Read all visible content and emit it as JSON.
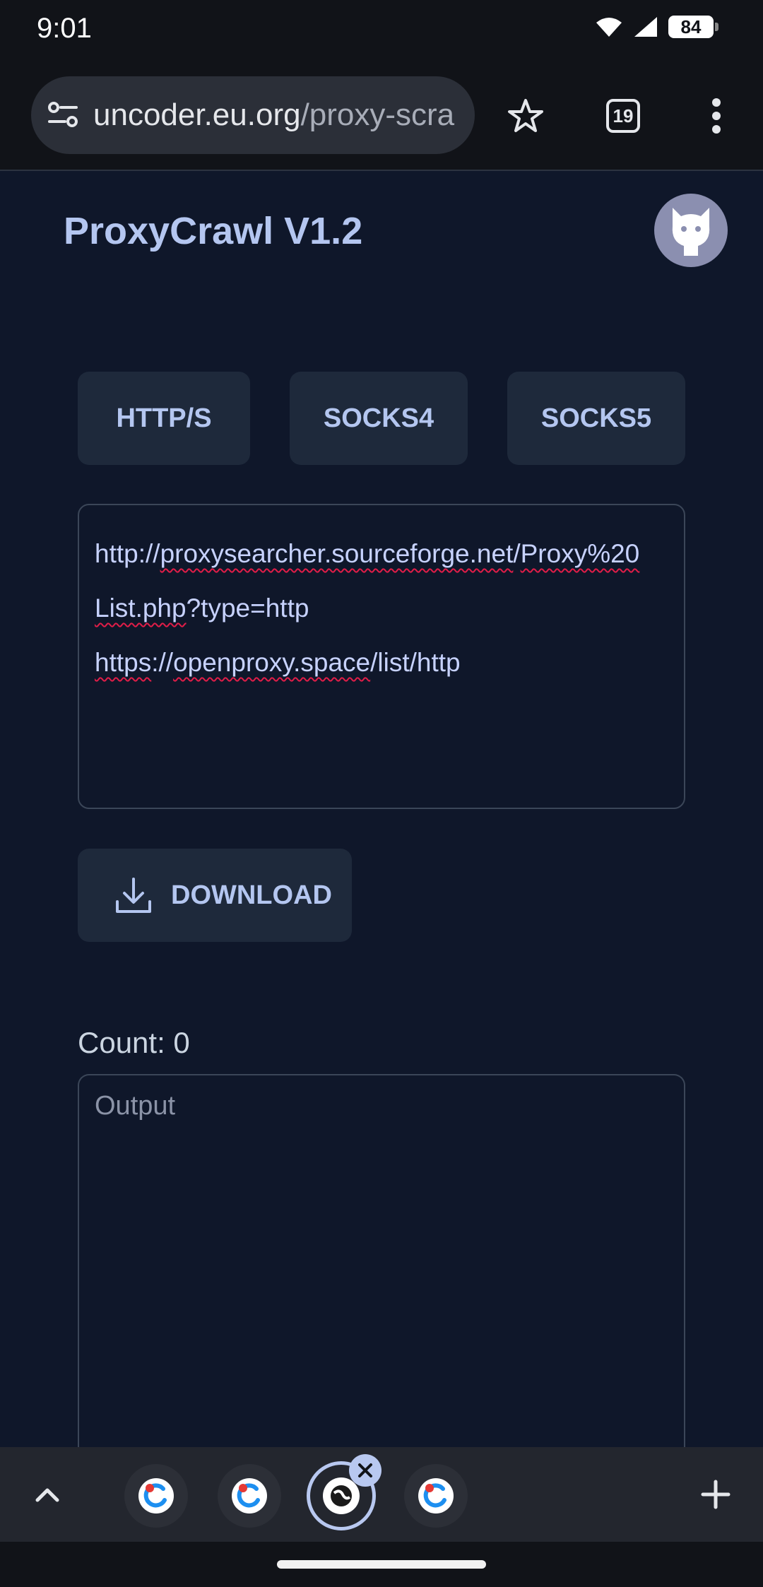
{
  "status": {
    "time": "9:01",
    "battery": "84"
  },
  "browser": {
    "url_host": "uncoder.eu.org",
    "url_path": "/proxy-scra",
    "tab_count": "19"
  },
  "app": {
    "title": "ProxyCrawl V1.2",
    "types": [
      {
        "label": "HTTP/S"
      },
      {
        "label": "SOCKS4"
      },
      {
        "label": "SOCKS5"
      }
    ],
    "sources": {
      "line1_prefix": "http://",
      "line1_host": "proxysearcher.sourceforge.net",
      "line1_sep": "/",
      "line1_path": "Proxy%20",
      "line2_word": "List.php",
      "line2_rest": "?type=http",
      "line3_scheme": "https",
      "line3_sep": "://",
      "line3_host": "openproxy.space",
      "line3_path": "/list/http"
    },
    "download_label": "DOWNLOAD",
    "count_label": "Count: 0",
    "output_placeholder": "Output"
  },
  "tab_strip": {
    "tabs": [
      {
        "icon": "app-tab-icon"
      },
      {
        "icon": "app-tab-icon"
      },
      {
        "icon": "globe-tab-icon",
        "active": true
      },
      {
        "icon": "app-tab-icon"
      }
    ]
  },
  "colors": {
    "background": "#0f172a",
    "button": "#1e293b",
    "accent_text": "#b4c6f0"
  }
}
